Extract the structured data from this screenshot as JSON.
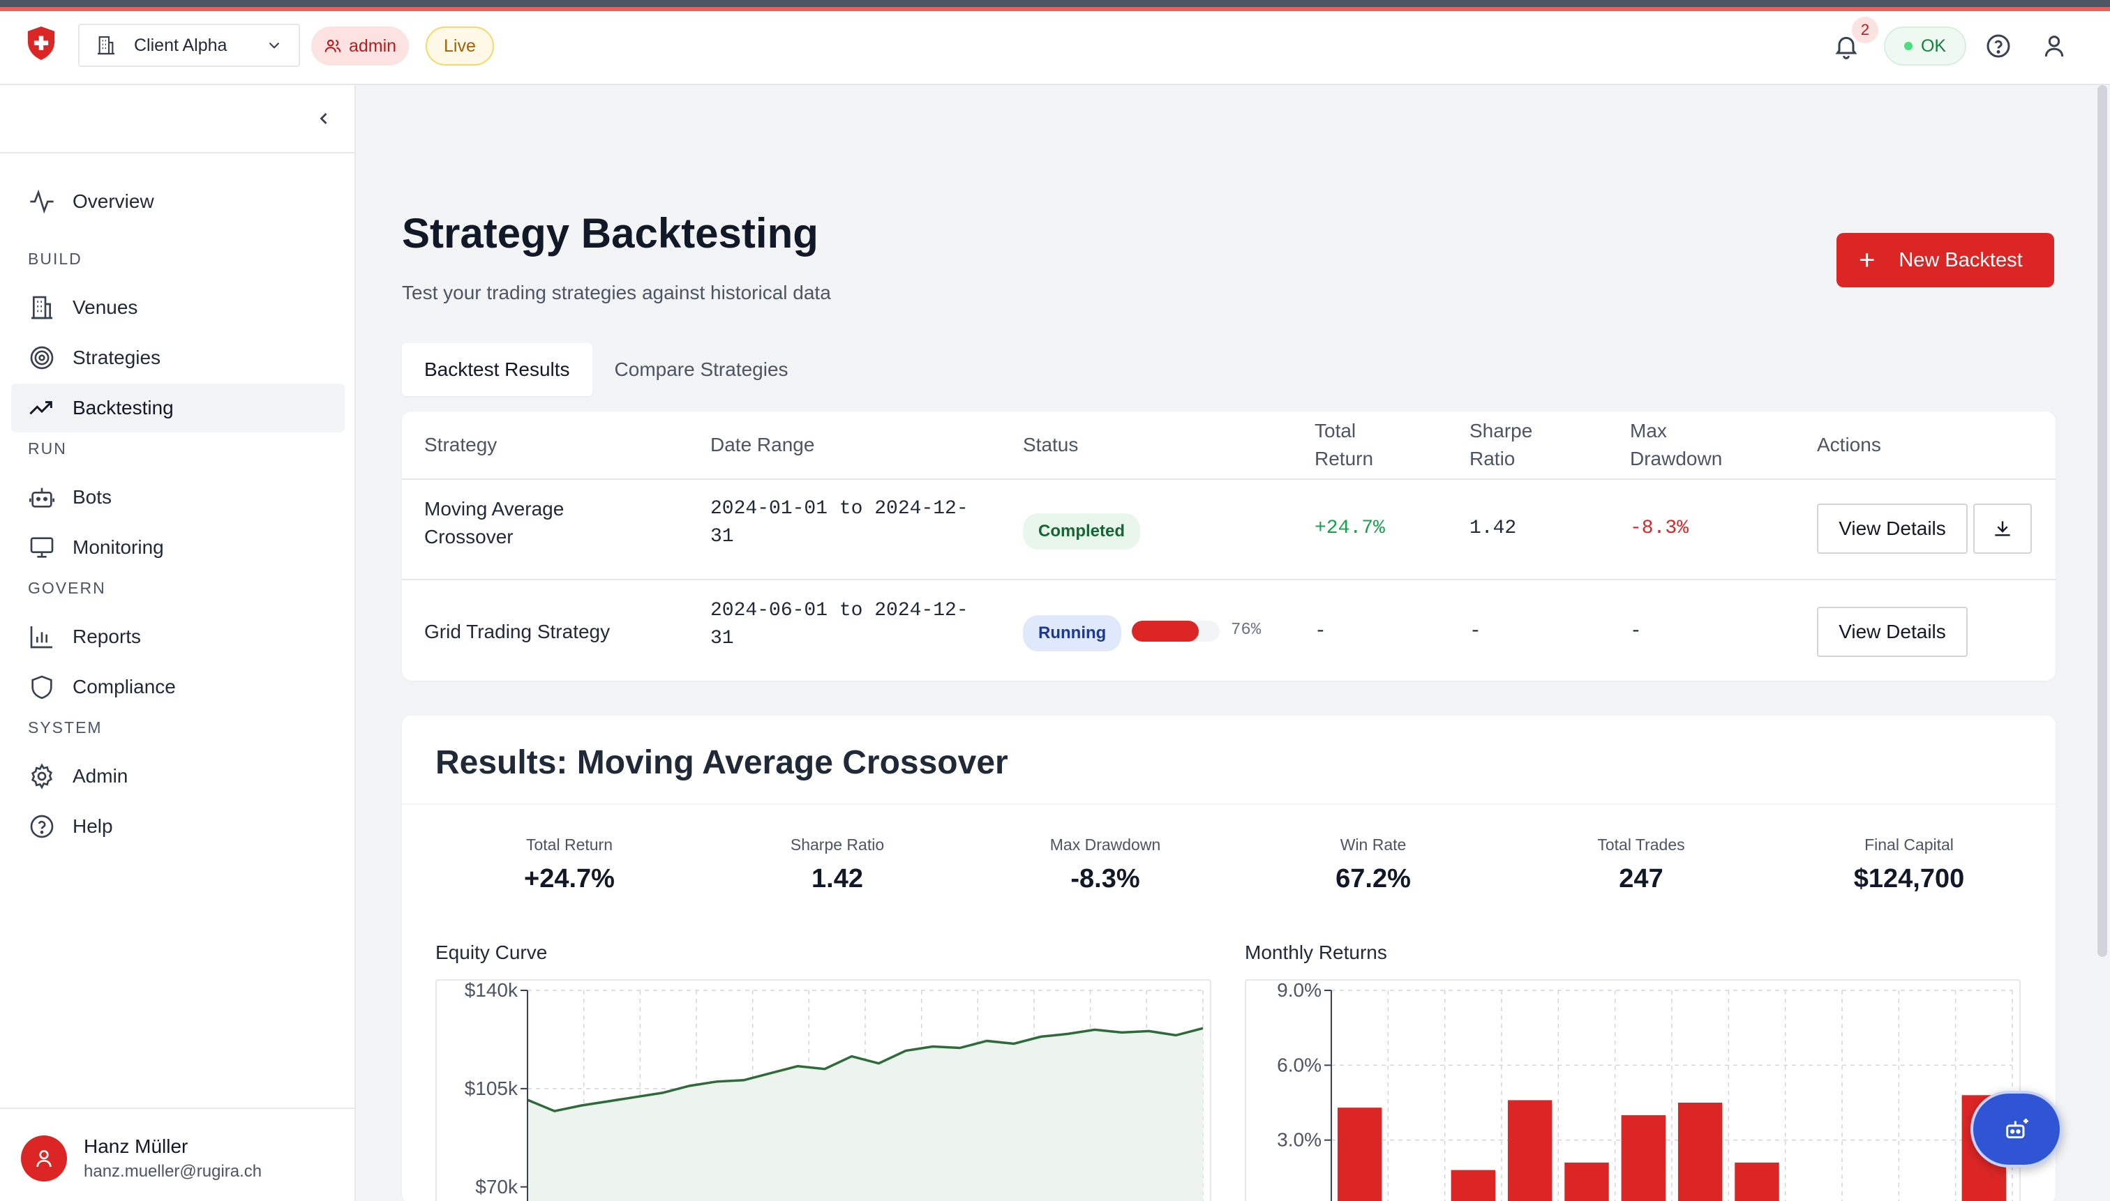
{
  "header": {
    "client": "Client Alpha",
    "role": "admin",
    "env": "Live",
    "notifications": "2",
    "status": "OK"
  },
  "sidebar": {
    "items": [
      {
        "label": "Overview"
      },
      {
        "label": "Venues"
      },
      {
        "label": "Strategies"
      },
      {
        "label": "Backtesting"
      },
      {
        "label": "Bots"
      },
      {
        "label": "Monitoring"
      },
      {
        "label": "Reports"
      },
      {
        "label": "Compliance"
      },
      {
        "label": "Admin"
      },
      {
        "label": "Help"
      }
    ],
    "sections": [
      "BUILD",
      "RUN",
      "GOVERN",
      "SYSTEM"
    ],
    "active": "Backtesting"
  },
  "user": {
    "name": "Hanz Müller",
    "email": "hanz.mueller@rugira.ch"
  },
  "page": {
    "title": "Strategy Backtesting",
    "subtitle": "Test your trading strategies against historical data",
    "new_button": "New Backtest"
  },
  "tabs": [
    "Backtest Results",
    "Compare Strategies"
  ],
  "table": {
    "headers": {
      "strategy": "Strategy",
      "date_range": "Date Range",
      "status": "Status",
      "total_return_1": "Total",
      "total_return_2": "Return",
      "sharpe_1": "Sharpe",
      "sharpe_2": "Ratio",
      "drawdown_1": "Max",
      "drawdown_2": "Drawdown",
      "actions": "Actions"
    },
    "rows": [
      {
        "strategy_1": "Moving Average",
        "strategy_2": "Crossover",
        "date_1": "2024-01-01 to 2024-12-",
        "date_2": "31",
        "status": "Completed",
        "total_return": "+24.7%",
        "sharpe": "1.42",
        "drawdown": "-8.3%",
        "action": "View Details"
      },
      {
        "strategy_1": "Grid Trading Strategy",
        "date_1": "2024-06-01 to 2024-12-",
        "date_2": "31",
        "status": "Running",
        "progress": 0.76,
        "progress_label": "76%",
        "total_return": "-",
        "sharpe": "-",
        "drawdown": "-",
        "action": "View Details"
      }
    ]
  },
  "results": {
    "title": "Results: Moving Average Crossover",
    "metrics": [
      {
        "label": "Total Return",
        "value": "+24.7%"
      },
      {
        "label": "Sharpe Ratio",
        "value": "1.42"
      },
      {
        "label": "Max Drawdown",
        "value": "-8.3%"
      },
      {
        "label": "Win Rate",
        "value": "67.2%"
      },
      {
        "label": "Total Trades",
        "value": "247"
      },
      {
        "label": "Final Capital",
        "value": "$124,700"
      }
    ],
    "equity_title": "Equity Curve",
    "monthly_title": "Monthly Returns"
  },
  "colors": {
    "brand": "#dc2626",
    "positive": "#16a34a",
    "negative": "#dc2626",
    "equity_line": "#2f6b3a",
    "equity_fill": "#edf3ee"
  },
  "chart_data": [
    {
      "type": "area",
      "y_ticks": [
        "$140k",
        "$105k",
        "$70k"
      ],
      "y_tick_values": [
        140000,
        105000,
        70000
      ],
      "x": [
        0,
        10,
        20,
        30,
        40,
        50,
        60,
        70,
        80,
        90,
        100,
        110,
        120,
        130,
        140,
        150,
        160,
        170,
        180,
        190,
        200,
        210,
        220,
        230,
        240,
        250
      ],
      "values": [
        101000,
        97000,
        99000,
        100500,
        102000,
        103500,
        106000,
        107500,
        108000,
        110500,
        113000,
        112000,
        116500,
        114000,
        118500,
        120000,
        119500,
        122000,
        121000,
        123500,
        124500,
        126000,
        125000,
        125500,
        124000,
        126500
      ],
      "ylim": [
        60000,
        140000
      ]
    },
    {
      "type": "bar",
      "y_ticks": [
        "9.0%",
        "6.0%",
        "3.0%"
      ],
      "y_tick_values": [
        9.0,
        6.0,
        3.0
      ],
      "values": [
        4.3,
        0,
        1.8,
        4.6,
        2.1,
        4.0,
        4.5,
        2.1,
        0.4,
        0,
        0,
        4.8
      ],
      "ylim": [
        0,
        9.0
      ]
    }
  ]
}
